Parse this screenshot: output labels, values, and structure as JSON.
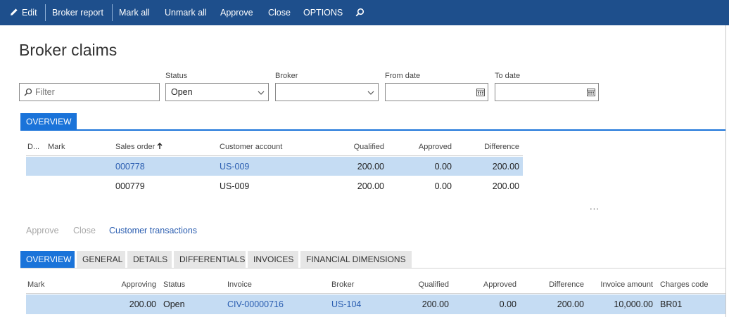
{
  "toolbar": {
    "edit": "Edit",
    "broker_report": "Broker report",
    "mark_all": "Mark all",
    "unmark_all": "Unmark all",
    "approve": "Approve",
    "close": "Close",
    "options": "OPTIONS",
    "edit_icon": "pencil-icon",
    "search_icon": "search-icon"
  },
  "page": {
    "title": "Broker claims"
  },
  "filters": {
    "filter_placeholder": "Filter",
    "status_label": "Status",
    "status_value": "Open",
    "broker_label": "Broker",
    "broker_value": "",
    "from_date_label": "From date",
    "from_date_value": "",
    "to_date_label": "To date",
    "to_date_value": ""
  },
  "overview_tab": "OVERVIEW",
  "grid": {
    "headers": {
      "d": "D...",
      "mark": "Mark",
      "sales_order": "Sales order",
      "customer_account": "Customer account",
      "qualified": "Qualified",
      "approved": "Approved",
      "difference": "Difference"
    },
    "rows": [
      {
        "sales_order": "000778",
        "customer_account": "US-009",
        "qualified": "200.00",
        "approved": "0.00",
        "difference": "200.00",
        "selected": true
      },
      {
        "sales_order": "000779",
        "customer_account": "US-009",
        "qualified": "200.00",
        "approved": "0.00",
        "difference": "200.00",
        "selected": false
      }
    ],
    "more": "..."
  },
  "line_actions": {
    "approve": "Approve",
    "close": "Close",
    "customer_transactions": "Customer transactions"
  },
  "detail_tabs": [
    "OVERVIEW",
    "GENERAL",
    "DETAILS",
    "DIFFERENTIALS",
    "INVOICES",
    "FINANCIAL DIMENSIONS"
  ],
  "detail_grid": {
    "headers": {
      "mark": "Mark",
      "approving": "Approving",
      "status": "Status",
      "invoice": "Invoice",
      "broker": "Broker",
      "qualified": "Qualified",
      "approved": "Approved",
      "difference": "Difference",
      "invoice_amount": "Invoice amount",
      "charges_code": "Charges code"
    },
    "rows": [
      {
        "approving": "200.00",
        "status": "Open",
        "invoice": "CIV-00000716",
        "broker": "US-104",
        "qualified": "200.00",
        "approved": "0.00",
        "difference": "200.00",
        "invoice_amount": "10,000.00",
        "charges_code": "BR01"
      }
    ]
  },
  "colors": {
    "topbar": "#1e4f8c",
    "accent": "#1a73d9",
    "selected_row": "#c5dcf3",
    "link": "#2a5db0"
  }
}
